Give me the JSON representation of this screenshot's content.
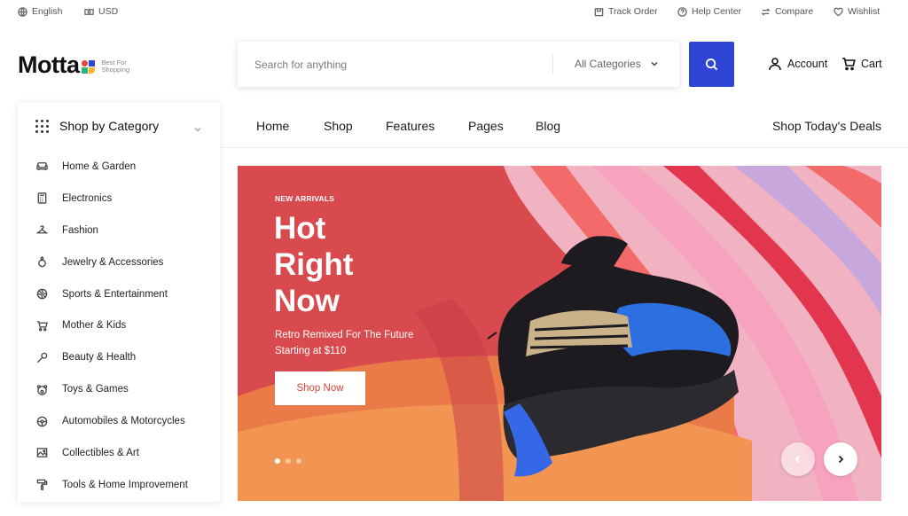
{
  "topbar": {
    "language": "English",
    "currency": "USD",
    "track_order": "Track Order",
    "help_center": "Help Center",
    "compare": "Compare",
    "wishlist": "Wishlist"
  },
  "brand": {
    "name": "Motta",
    "tagline_line1": "Best For",
    "tagline_line2": "Shopping",
    "mark_colors": [
      "#e4463b",
      "#2f45d6",
      "#2bb673",
      "#f7b733"
    ]
  },
  "search": {
    "placeholder": "Search for anything",
    "category_selected": "All Categories"
  },
  "header": {
    "account_label": "Account",
    "cart_label": "Cart"
  },
  "nav": {
    "items": [
      "Home",
      "Shop",
      "Features",
      "Pages",
      "Blog"
    ],
    "deals_label": "Shop Today's Deals"
  },
  "sidebar": {
    "title": "Shop by Category",
    "items": [
      {
        "label": "Home & Garden",
        "icon": "sofa-icon"
      },
      {
        "label": "Electronics",
        "icon": "calculator-icon"
      },
      {
        "label": "Fashion",
        "icon": "hanger-icon"
      },
      {
        "label": "Jewelry & Accessories",
        "icon": "ring-icon"
      },
      {
        "label": "Sports & Entertainment",
        "icon": "ball-icon"
      },
      {
        "label": "Mother & Kids",
        "icon": "stroller-icon"
      },
      {
        "label": "Beauty & Health",
        "icon": "brush-icon"
      },
      {
        "label": "Toys & Games",
        "icon": "teddy-icon"
      },
      {
        "label": "Automobiles & Motorcycles",
        "icon": "steering-wheel-icon"
      },
      {
        "label": "Collectibles & Art",
        "icon": "picture-icon"
      },
      {
        "label": "Tools & Home Improvement",
        "icon": "paint-roller-icon"
      }
    ]
  },
  "hero": {
    "kicker": "NEW ARRIVALS",
    "title_line1": "Hot",
    "title_line2": "Right",
    "title_line3": "Now",
    "subtitle_line1": "Retro Remixed For The Future",
    "subtitle_line2": "Starting at $110",
    "button_label": "Shop Now",
    "slide_count": 3,
    "active_slide": 1,
    "accent_color": "#d8433b"
  },
  "colors": {
    "primary": "#2f45d6",
    "hero_bg": "#d84a4f"
  }
}
